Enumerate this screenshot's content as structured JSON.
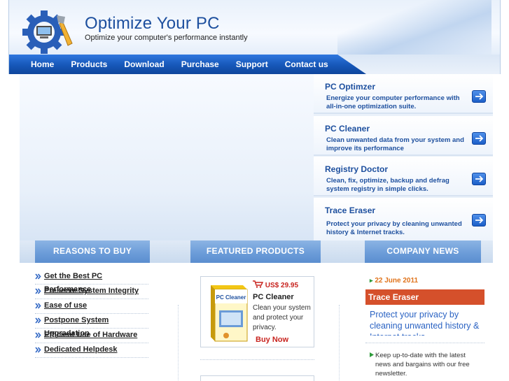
{
  "brand": {
    "title": "Optimize Your PC",
    "subtitle": "Optimize your computer's performance instantly"
  },
  "nav": {
    "items": [
      "Home",
      "Products",
      "Download",
      "Purchase",
      "Support",
      "Contact us"
    ]
  },
  "promos": [
    {
      "title": "PC Optimzer",
      "desc": "Energize your computer performance with all-in-one optimization suite."
    },
    {
      "title": "PC Cleaner",
      "desc": "Clean unwanted data from your system and improve its performance"
    },
    {
      "title": "Registry Doctor",
      "desc": "Clean, fix, optimize, backup and defrag system registry in simple clicks."
    },
    {
      "title": "Trace Eraser",
      "desc": "Protect your privacy by cleaning unwanted history & Internet tracks."
    }
  ],
  "sections": {
    "reasons": "REASONS TO BUY",
    "featured": "FEATURED PRODUCTS",
    "news": "COMPANY NEWS"
  },
  "reasons": [
    "Get the Best PC Performance",
    "Preserve System Integrity",
    "Ease of use",
    "Postpone System Upgradation",
    "Efficient Use of Hardware",
    "Dedicated Helpdesk"
  ],
  "featured_product": {
    "price": "US$ 29.95",
    "name": "PC Cleaner",
    "desc": "Clean your system and protect your privacy.",
    "buy_label": "Buy Now",
    "box_label": "PC Cleaner"
  },
  "news": {
    "date": "22 June 2011",
    "title": "Trace Eraser",
    "body": "Protect your privacy by cleaning unwanted history & Internet tracks.",
    "newsletter": "Keep up-to-date with the latest news and bargains with our free newsletter."
  },
  "colors": {
    "brand_blue": "#1d4f9e",
    "nav_blue": "#1657b8",
    "accent_red": "#c8241f",
    "news_orange": "#d5502b"
  }
}
